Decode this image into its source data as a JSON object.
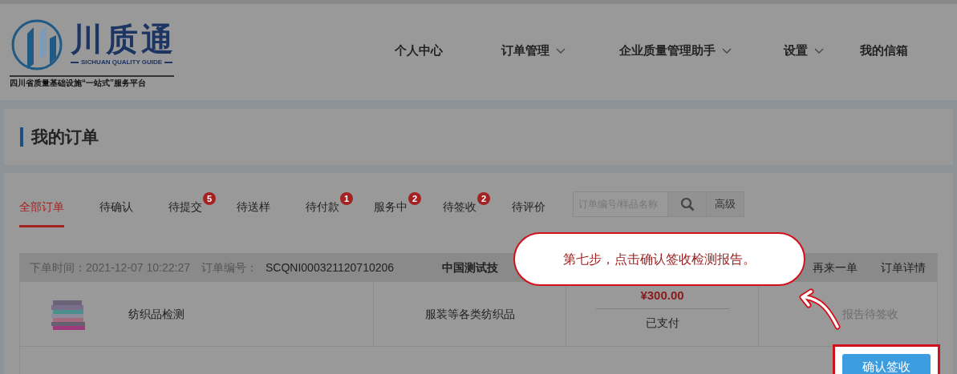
{
  "logo": {
    "title": "川质通",
    "subtitle": "SICHUAN QUALITY GUIDE",
    "slogan": "四川省质量基础设施“一站式”服务平台"
  },
  "nav": [
    {
      "label": "个人中心",
      "dropdown": false
    },
    {
      "label": "订单管理",
      "dropdown": true
    },
    {
      "label": "企业质量管理助手",
      "dropdown": true
    },
    {
      "label": "设置",
      "dropdown": true
    },
    {
      "label": "我的信箱",
      "dropdown": false
    }
  ],
  "page_title": "我的订单",
  "tabs": [
    {
      "label": "全部订单",
      "selected": true
    },
    {
      "label": "待确认",
      "selected": false
    },
    {
      "label": "待提交",
      "selected": false,
      "badge": "5"
    },
    {
      "label": "待送样",
      "selected": false
    },
    {
      "label": "待付款",
      "selected": false,
      "badge": "1"
    },
    {
      "label": "服务中",
      "selected": false,
      "badge": "2"
    },
    {
      "label": "待签收",
      "selected": false,
      "badge": "2"
    },
    {
      "label": "待评价",
      "selected": false
    }
  ],
  "search": {
    "placeholder": "订单编号/样品名称",
    "advanced": "高级"
  },
  "order": {
    "time_label": "下单时间：",
    "time": "2021-12-07 10:22:27",
    "number_label": "订单编号：",
    "number": "SCQNI000321120710206",
    "lab": "中国测试技",
    "actions": [
      "再来一单",
      "订单详情"
    ],
    "product": "纺织品检测",
    "category": "服装等各类纺织品",
    "price": "¥300.00",
    "payment": "已支付",
    "status": "报告待签收"
  },
  "confirm_button": "确认签收",
  "callout": "第七步，点击确认签收检测报告。"
}
